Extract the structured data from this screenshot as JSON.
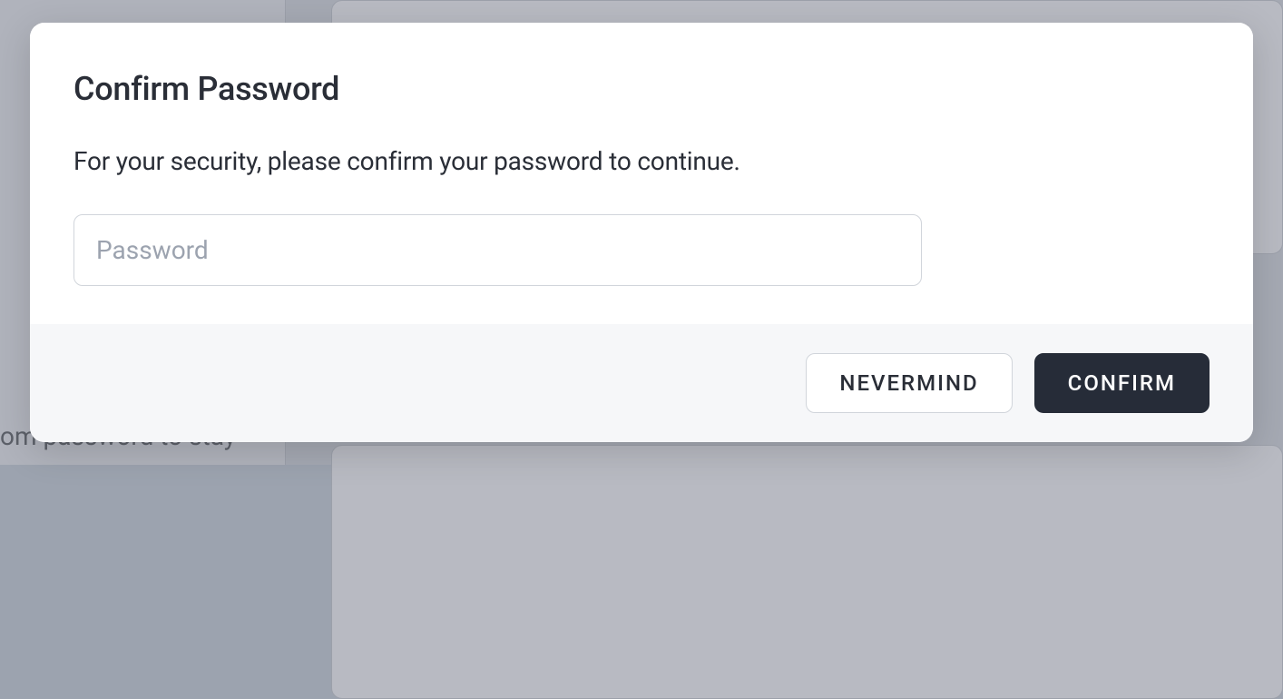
{
  "background": {
    "partial_text": "om password to stay"
  },
  "modal": {
    "title": "Confirm Password",
    "subtitle": "For your security, please confirm your password to continue.",
    "password_placeholder": "Password",
    "password_value": "",
    "buttons": {
      "cancel_label": "NEVERMIND",
      "confirm_label": "CONFIRM"
    }
  }
}
